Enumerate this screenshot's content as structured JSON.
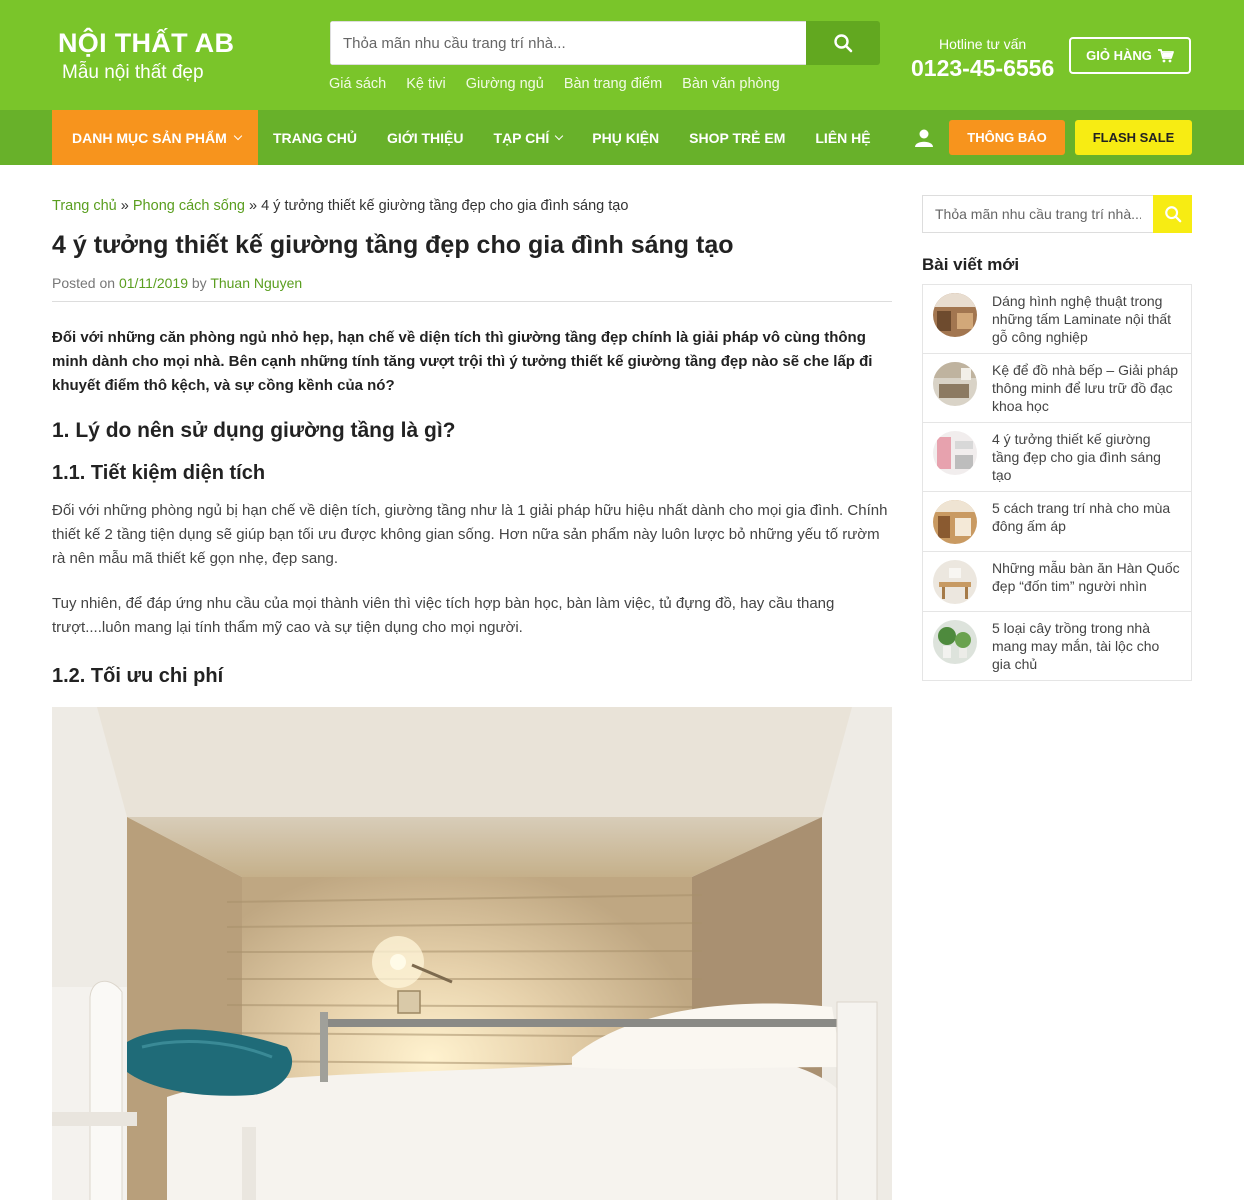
{
  "header": {
    "logo_title": "NỘI THẤT AB",
    "logo_subtitle": "Mẫu nội thất đẹp",
    "search_placeholder": "Thỏa mãn nhu cầu trang trí nhà...",
    "quick_links": [
      "Giá sách",
      "Kệ tivi",
      "Giường ngủ",
      "Bàn trang điểm",
      "Bàn văn phòng"
    ],
    "hotline_label": "Hotline tư vấn",
    "hotline_number": "0123-45-6556",
    "cart_label": "GIỎ HÀNG"
  },
  "nav": {
    "category_label": "DANH MỤC SẢN PHẨM",
    "items": [
      "TRANG CHỦ",
      "GIỚI THIỆU",
      "TẠP CHÍ",
      "PHỤ KIỆN",
      "SHOP TRẺ EM",
      "LIÊN HỆ"
    ],
    "notice_label": "THÔNG BÁO",
    "flash_sale_label": "FLASH SALE"
  },
  "breadcrumb": {
    "home": "Trang chủ",
    "category": "Phong cách sống",
    "sep": "»",
    "current": "4 ý tưởng thiết kế giường tầng đẹp cho gia đình sáng tạo"
  },
  "post": {
    "title": "4 ý tưởng thiết kế giường tầng đẹp cho gia đình sáng tạo",
    "meta_posted": "Posted on",
    "meta_date": "01/11/2019",
    "meta_by": "by",
    "meta_author": "Thuan Nguyen",
    "intro": "Đối với những căn phòng ngủ nhỏ hẹp, hạn chế về diện tích thì giường tầng đẹp chính là giải pháp vô cùng thông minh dành cho mọi nhà. Bên cạnh những tính tăng vượt trội thì ý tưởng thiết kế giường tầng đẹp nào sẽ che lấp đi khuyết điểm thô kệch, và sự cồng kềnh của nó?",
    "h2": "1. Lý do nên sử dụng giường tầng là gì?",
    "h3_1": "1.1. Tiết kiệm diện tích",
    "para1": "Đối với những phòng ngủ bị hạn chế về diện tích, giường tầng như là 1 giải pháp hữu hiệu nhất dành cho mọi gia đình. Chính thiết kế 2 tầng tiện dụng sẽ giúp bạn tối ưu được không gian sống. Hơn nữa sản phẩm này luôn lược bỏ những yếu tố rườm rà nên mẫu mã thiết kế gọn nhẹ, đẹp sang.",
    "para2": "Tuy nhiên, để đáp ứng nhu cầu của mọi thành viên thì việc tích hợp bàn học, bàn làm việc, tủ đựng đồ, hay cầu thang trượt....luôn mang lại tính thẩm mỹ cao và sự tiện dụng cho mọi người.",
    "h3_2": "1.2. Tối ưu chi phí"
  },
  "sidebar": {
    "search_placeholder": "Thỏa mãn nhu cầu trang trí nhà...",
    "heading": "Bài viết mới",
    "recent_posts": [
      "Dáng hình nghệ thuật trong những tấm Laminate nội thất gỗ công nghiệp",
      "Kệ để đồ nhà bếp – Giải pháp thông minh để lưu trữ đồ đạc khoa học",
      "4 ý tưởng thiết kế giường tầng đẹp cho gia đình sáng tạo",
      "5 cách trang trí nhà cho mùa đông ấm áp",
      "Những mẫu bàn ăn Hàn Quốc đẹp “đốn tim” người nhìn",
      "5 loại cây trồng trong nhà mang may mắn, tài lộc cho gia chủ"
    ]
  },
  "colors": {
    "header_green": "#7ac52a",
    "nav_green": "#68b12a",
    "orange": "#f7941d",
    "yellow": "#f7ec13",
    "link_green": "#5a9e1f"
  },
  "icons": [
    "search-icon",
    "cart-icon",
    "chevron-down-icon",
    "user-icon"
  ]
}
